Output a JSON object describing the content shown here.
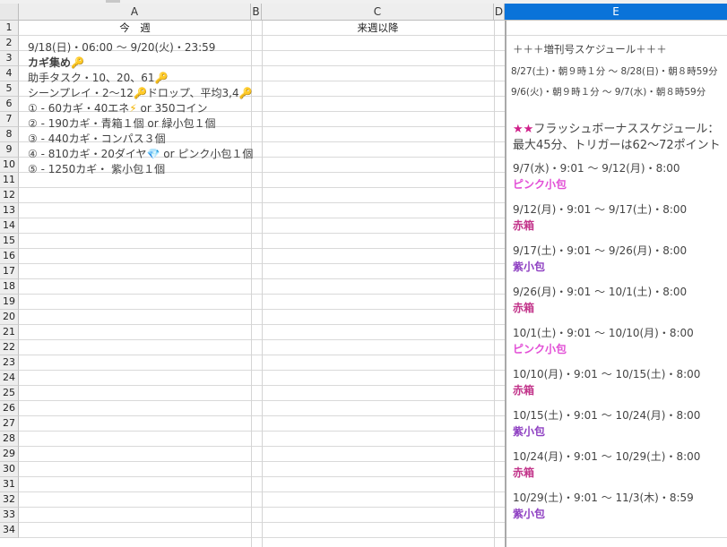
{
  "columns": [
    "A",
    "B",
    "C",
    "D",
    "E"
  ],
  "selected_column": "E",
  "rows": [
    "1",
    "2",
    "3",
    "4",
    "5",
    "6",
    "7",
    "8",
    "9",
    "10",
    "11",
    "12",
    "13",
    "14",
    "15",
    "16",
    "17",
    "18",
    "19",
    "20",
    "21",
    "22",
    "23",
    "24",
    "25",
    "26",
    "27",
    "28",
    "29",
    "30",
    "31",
    "32",
    "33",
    "34"
  ],
  "headers": {
    "a1": "今　週",
    "c1": "来週以降"
  },
  "this_week": {
    "period": "9/18(日)・06:00 〜 9/20(火)・23:59",
    "key_collect": "カギ集め",
    "helper_task": "助手タスク・10、20、61",
    "scene_play_a": "シーンプレイ・2〜12",
    "scene_play_b": "ドロップ、平均3,4",
    "reward_1a": "① - 60カギ・40エネ",
    "reward_1b": " or 350コイン",
    "reward_2": "② - 190カギ・青箱１個 or 緑小包１個",
    "reward_3": "③ - 440カギ・コンパス３個",
    "reward_4a": "④ - 810カギ・20ダイヤ",
    "reward_4b": " or ピンク小包１個",
    "reward_5": "⑤ - 1250カギ・ 紫小包１個"
  },
  "icons": {
    "key": "key-icon",
    "bolt": "lightning-icon",
    "gem": "diamond-icon"
  },
  "glyphs": {
    "key": "🔑",
    "bolt": "⚡",
    "gem": "💎"
  },
  "issue_schedule": {
    "title": "＋＋＋増刊号スケジュール＋＋＋",
    "items": [
      "8/27(土)・朝９時１分 〜 8/28(日)・朝８時59分",
      "9/6(火)・朝９時１分 〜 9/7(水)・朝８時59分"
    ]
  },
  "flash_bonus": {
    "title": "★★フラッシュボーナススケジュール：",
    "title_stars": "★★",
    "title_text": "フラッシュボーナススケジュール：",
    "subtitle": "最大45分、トリガーは62〜72ポイント",
    "entries": [
      {
        "period": "9/7(水)・9:01 〜 9/12(月)・8:00",
        "reward": "ピンク小包",
        "color": "#e24fd6"
      },
      {
        "period": "9/12(月)・9:01 〜 9/17(土)・8:00",
        "reward": "赤箱",
        "color": "#c2348a"
      },
      {
        "period": "9/17(土)・9:01 〜 9/26(月)・8:00",
        "reward": "紫小包",
        "color": "#8e3fc2"
      },
      {
        "period": "9/26(月)・9:01 〜 10/1(土)・8:00",
        "reward": "赤箱",
        "color": "#c2348a"
      },
      {
        "period": "10/1(土)・9:01 〜 10/10(月)・8:00",
        "reward": "ピンク小包",
        "color": "#e24fd6"
      },
      {
        "period": "10/10(月)・9:01 〜 10/15(土)・8:00",
        "reward": "赤箱",
        "color": "#c2348a"
      },
      {
        "period": "10/15(土)・9:01 〜 10/24(月)・8:00",
        "reward": "紫小包",
        "color": "#8e3fc2"
      },
      {
        "period": "10/24(月)・9:01 〜 10/29(土)・8:00",
        "reward": "赤箱",
        "color": "#c2348a"
      },
      {
        "period": "10/29(土)・9:01 〜 11/3(木)・8:59",
        "reward": "紫小包",
        "color": "#8e3fc2"
      }
    ]
  },
  "colors": {
    "selected_header": "#0a73d9",
    "green": "#1fb31f",
    "magenta": "#d0208a"
  }
}
